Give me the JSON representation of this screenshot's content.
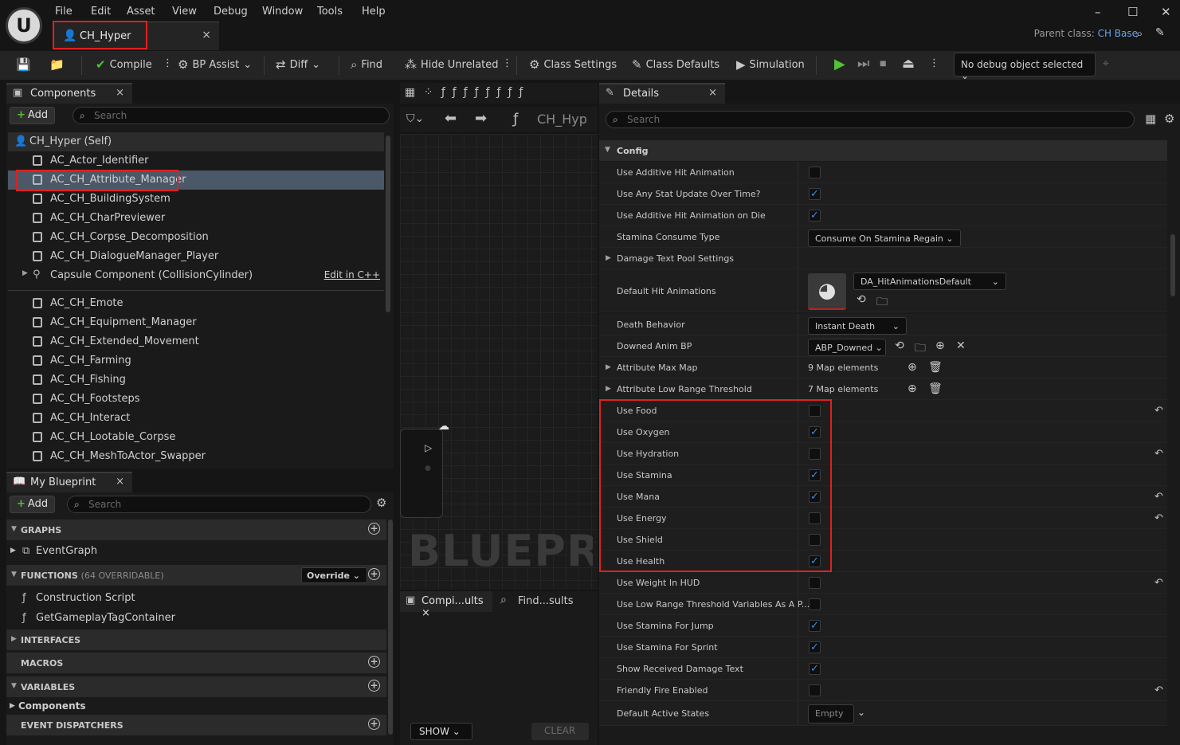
{
  "menu": [
    "File",
    "Edit",
    "Asset",
    "View",
    "Debug",
    "Window",
    "Tools",
    "Help"
  ],
  "window_controls": {
    "minimize": "–",
    "maximize": "☐",
    "close": "✕"
  },
  "document_tab": {
    "title": "CH_Hyper",
    "close": "×"
  },
  "parent_class": {
    "label": "Parent class:",
    "value": "CH Base"
  },
  "toolbar": {
    "compile": "Compile",
    "bp_assist": "BP Assist",
    "diff": "Diff",
    "find": "Find",
    "hide_unrelated": "Hide Unrelated",
    "class_settings": "Class Settings",
    "class_defaults": "Class Defaults",
    "simulation": "Simulation",
    "debug_object": "No debug object selected"
  },
  "components_panel": {
    "tab": "Components",
    "add": "Add",
    "search_placeholder": "Search",
    "self": "CH_Hyper (Self)",
    "items": [
      "AC_Actor_Identifier",
      "AC_CH_Attribute_Manager",
      "AC_CH_BuildingSystem",
      "AC_CH_CharPreviewer",
      "AC_CH_Corpse_Decomposition",
      "AC_CH_DialogueManager_Player",
      "Capsule Component (CollisionCylinder)",
      "AC_CH_Emote",
      "AC_CH_Equipment_Manager",
      "AC_CH_Extended_Movement",
      "AC_CH_Farming",
      "AC_CH_Fishing",
      "AC_CH_Footsteps",
      "AC_CH_Interact",
      "AC_CH_Lootable_Corpse",
      "AC_CH_MeshToActor_Swapper"
    ],
    "edit_in_cpp": "Edit in C++"
  },
  "my_blueprint": {
    "tab": "My Blueprint",
    "add": "Add",
    "search_placeholder": "Search",
    "graphs": "GRAPHS",
    "event_graph": "EventGraph",
    "functions": "FUNCTIONS",
    "functions_count": "(64 OVERRIDABLE)",
    "override": "Override",
    "construction_script": "Construction Script",
    "get_tag_container": "GetGameplayTagContainer",
    "interfaces": "INTERFACES",
    "macros": "MACROS",
    "variables": "VARIABLES",
    "components": "Components",
    "event_dispatchers": "EVENT DISPATCHERS"
  },
  "graph": {
    "breadcrumb": "CH_Hyp",
    "watermark": "BLUEPRI",
    "compiler_results": "Compi...ults",
    "find_results": "Find...sults",
    "show": "SHOW",
    "clear": "CLEAR"
  },
  "details": {
    "tab": "Details",
    "search_placeholder": "Search",
    "section": "Config",
    "rows": [
      {
        "name": "Use Additive Hit Animation",
        "checked": false,
        "reset": false
      },
      {
        "name": "Use Any Stat Update Over Time?",
        "checked": true,
        "reset": false
      },
      {
        "name": "Use Additive Hit Animation on Die",
        "checked": true,
        "reset": false
      },
      {
        "name": "Stamina Consume Type",
        "dropdown": "Consume On Stamina Regain"
      },
      {
        "name": "Damage Text Pool Settings",
        "expandable": true
      },
      {
        "name": "Default Hit Animations",
        "asset": "DA_HitAnimationsDefault"
      },
      {
        "name": "Death Behavior",
        "dropdown": "Instant Death"
      },
      {
        "name": "Downed Anim BP",
        "dropdown": "ABP_Downed"
      },
      {
        "name": "Attribute Max Map",
        "map": "9 Map elements"
      },
      {
        "name": "Attribute Low Range Threshold",
        "map": "7 Map elements"
      },
      {
        "name": "Use Food",
        "checked": false,
        "reset": true
      },
      {
        "name": "Use Oxygen",
        "checked": true,
        "reset": false
      },
      {
        "name": "Use Hydration",
        "checked": false,
        "reset": true
      },
      {
        "name": "Use Stamina",
        "checked": true,
        "reset": false
      },
      {
        "name": "Use Mana",
        "checked": true,
        "reset": true
      },
      {
        "name": "Use Energy",
        "checked": false,
        "reset": true
      },
      {
        "name": "Use Shield",
        "checked": false,
        "reset": false
      },
      {
        "name": "Use Health",
        "checked": true,
        "reset": false
      },
      {
        "name": "Use Weight In HUD",
        "checked": false,
        "reset": true
      },
      {
        "name": "Use Low Range Threshold Variables As A P...",
        "checked": false,
        "reset": false
      },
      {
        "name": "Use Stamina For Jump",
        "checked": true,
        "reset": false
      },
      {
        "name": "Use Stamina For Sprint",
        "checked": true,
        "reset": false
      },
      {
        "name": "Show Received Damage Text",
        "checked": true,
        "reset": false
      },
      {
        "name": "Friendly Fire Enabled",
        "checked": false,
        "reset": true
      },
      {
        "name": "Default Active States",
        "dropdown": "Empty"
      }
    ]
  },
  "colors": {
    "accent_blue": "#3f8de0",
    "highlight_red": "#e02020",
    "play_green": "#52c234"
  }
}
